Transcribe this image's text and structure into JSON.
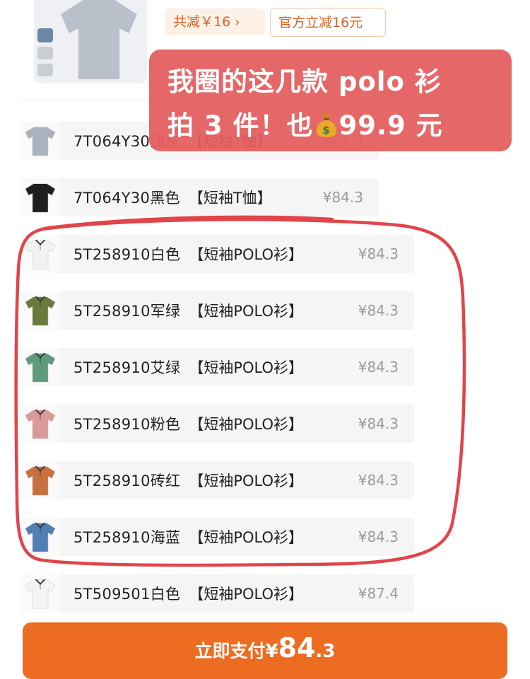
{
  "summary": {
    "total_discount": "共减￥16",
    "chevron": "›",
    "official_discount": "官方立减16元"
  },
  "annotation": {
    "line1": "我圈的这几款 polo 衫",
    "line2_prefix": "拍 3 件！也",
    "line2_suffix": "99.9 元",
    "icon": "money-bag-icon"
  },
  "items": [
    {
      "code": "7T064Y30浅灰",
      "tag": "【短袖T恤】",
      "price": "¥84.3",
      "color": "#a9b3bd",
      "style": "tee"
    },
    {
      "code": "7T064Y30黑色",
      "tag": "【短袖T恤】",
      "price": "¥84.3",
      "color": "#1f1f1f",
      "style": "tee"
    },
    {
      "code": "5T258910白色",
      "tag": "【短袖POLO衫】",
      "price": "¥84.3",
      "color": "#f2f2f2",
      "style": "polo"
    },
    {
      "code": "5T258910军绿",
      "tag": "【短袖POLO衫】",
      "price": "¥84.3",
      "color": "#6b7a3a",
      "style": "polo"
    },
    {
      "code": "5T258910艾绿",
      "tag": "【短袖POLO衫】",
      "price": "¥84.3",
      "color": "#5e9a7c",
      "style": "polo"
    },
    {
      "code": "5T258910粉色",
      "tag": "【短袖POLO衫】",
      "price": "¥84.3",
      "color": "#d99a98",
      "style": "polo"
    },
    {
      "code": "5T258910砖红",
      "tag": "【短袖POLO衫】",
      "price": "¥84.3",
      "color": "#c8703f",
      "style": "polo"
    },
    {
      "code": "5T258910海蓝",
      "tag": "【短袖POLO衫】",
      "price": "¥84.3",
      "color": "#4f7fb3",
      "style": "polo"
    },
    {
      "code": "5T509501白色",
      "tag": "【短袖POLO衫】",
      "price": "¥87.4",
      "color": "#f4f4f4",
      "style": "polo"
    }
  ],
  "pay_button": {
    "label": "立即支付",
    "currency": "¥",
    "amount_int": "84",
    "amount_dec": ".3"
  },
  "colors": {
    "accent_orange": "#ec6d21",
    "annotation_red": "#e45d5d",
    "circle_red": "#e0454a"
  }
}
